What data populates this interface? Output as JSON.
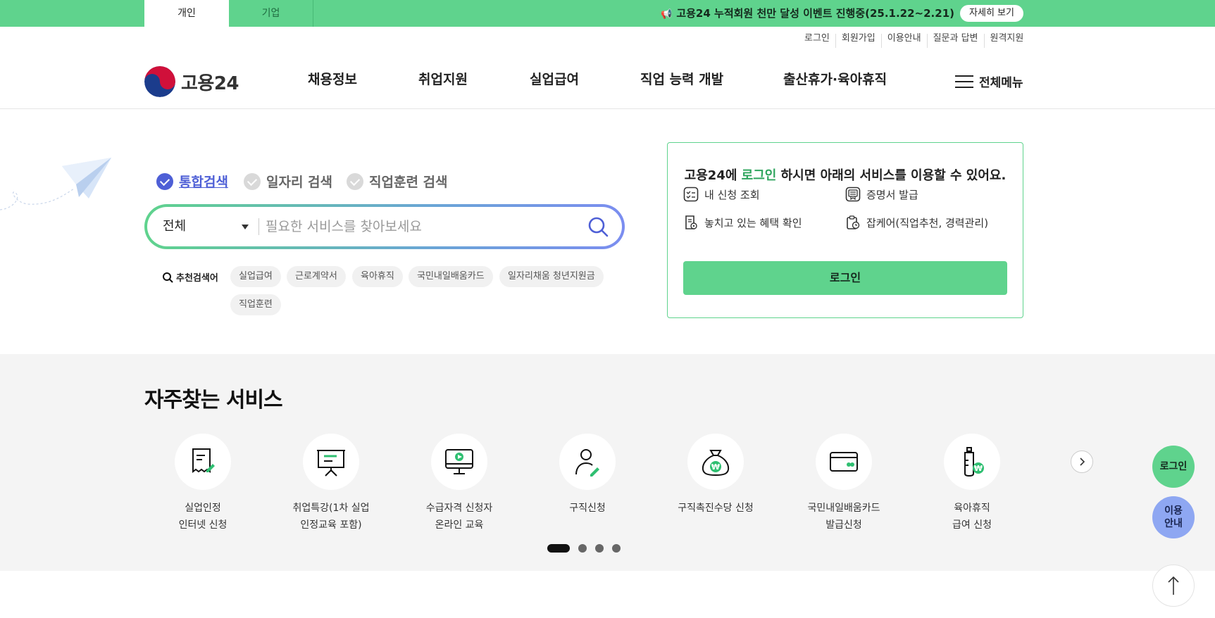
{
  "topbar": {
    "tabs": [
      "개인",
      "기업"
    ],
    "notice": "고용24 누적회원 천만 달성 이벤트 진행중(25.1.22~2.21)",
    "detail_label": "자세히 보기"
  },
  "util_links": [
    "로그인",
    "회원가입",
    "이용안내",
    "질문과 답변",
    "원격지원"
  ],
  "header": {
    "logo_text": "고용24",
    "nav": [
      "채용정보",
      "취업지원",
      "실업급여",
      "직업 능력 개발",
      "출산휴가·육아휴직"
    ],
    "all_menu": "전체메뉴"
  },
  "search": {
    "tabs": [
      "통합검색",
      "일자리 검색",
      "직업훈련 검색"
    ],
    "select_value": "전체",
    "placeholder": "필요한 서비스를 찾아보세요",
    "recommend_title": "추천검색어",
    "keywords": [
      "실업급여",
      "근로계약서",
      "육아휴직",
      "국민내일배움카드",
      "일자리채움 청년지원금",
      "직업훈련"
    ]
  },
  "login_box": {
    "title_prefix": "고용24에 ",
    "title_highlight": "로그인",
    "title_suffix": " 하시면 아래의 서비스를 이용할 수 있어요.",
    "items": [
      "내 신청 조회",
      "증명서 발급",
      "놓치고 있는 혜택 확인",
      "잡케어(직업추천, 경력관리)"
    ],
    "button": "로그인"
  },
  "frequent": {
    "title": "자주찾는 서비스",
    "services": [
      {
        "label": "실업인정\n인터넷 신청",
        "icon": "receipt-pen-icon"
      },
      {
        "label": "취업특강(1차 실업\n인정교육 포함)",
        "icon": "presentation-board-icon"
      },
      {
        "label": "수급자격 신청자\n온라인 교육",
        "icon": "monitor-play-icon"
      },
      {
        "label": "구직신청",
        "icon": "person-pen-icon"
      },
      {
        "label": "구직촉진수당 신청",
        "icon": "money-bag-icon"
      },
      {
        "label": "국민내일배움카드\n발급신청",
        "icon": "card-icon"
      },
      {
        "label": "육아휴직\n급여 신청",
        "icon": "baby-bottle-icon"
      }
    ]
  },
  "floating": {
    "login": "로그인",
    "guide_line1": "이용",
    "guide_line2": "안내"
  },
  "colors": {
    "brand_green": "#5fd38d",
    "accent_blue": "#4e5fd6",
    "section_gray": "#f4f4f4"
  }
}
